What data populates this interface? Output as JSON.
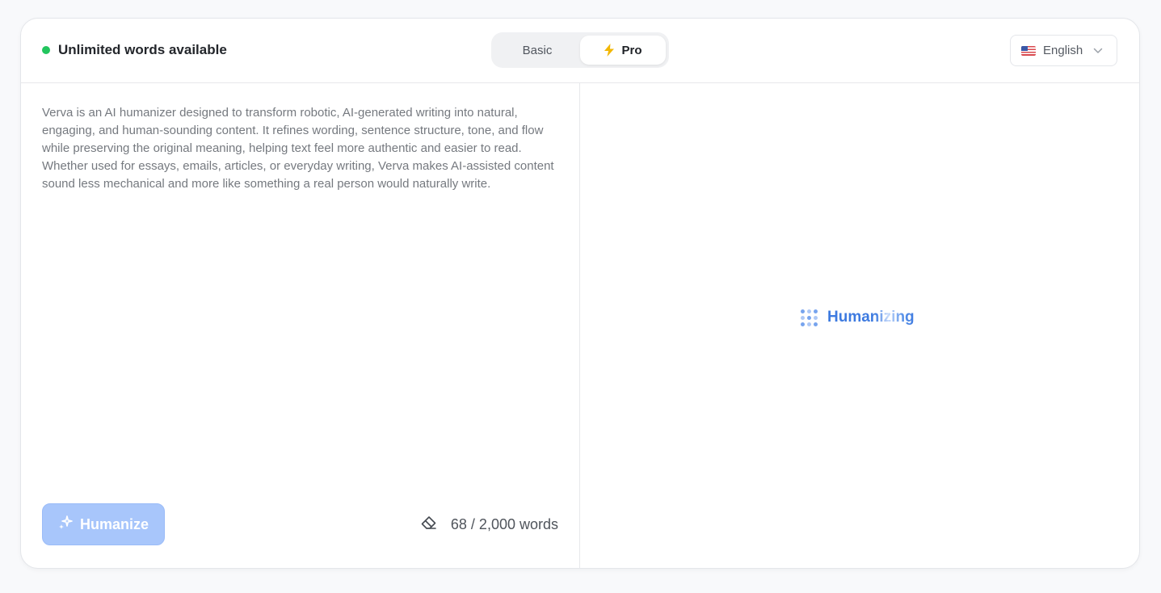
{
  "header": {
    "status_text": "Unlimited words available",
    "status_color": "#22c55e",
    "modes": [
      {
        "label": "Basic",
        "active": false
      },
      {
        "label": "Pro",
        "active": true,
        "icon": "lightning-bolt-icon"
      }
    ],
    "language": {
      "label": "English",
      "flag": "us-flag-icon"
    }
  },
  "editor": {
    "input_text": "Verva is an AI humanizer designed to transform robotic, AI-generated writing into natural, engaging, and human-sounding content. It refines wording, sentence structure, tone, and flow while preserving the original meaning, helping text feel more authentic and easier to read. Whether used for essays, emails, articles, or everyday writing, Verva makes AI-assisted content sound less mechanical and more like something a real person would naturally write.",
    "humanize_label": "Humanize",
    "word_count": "68 / 2,000 words"
  },
  "output": {
    "loading_text": "Humanizing",
    "accent_color": "#3d7ae0"
  }
}
